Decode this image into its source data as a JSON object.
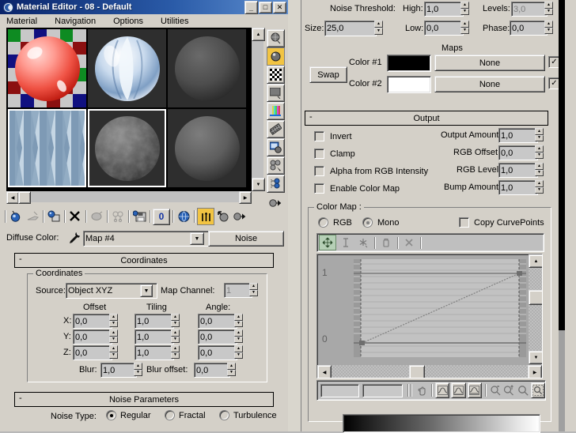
{
  "window": {
    "title": "Material Editor - 08 - Default",
    "system_icon": "material-editor-icon",
    "buttons": {
      "minimize": "_",
      "maximize": "□",
      "close": "✕"
    },
    "menu": [
      "Material",
      "Navigation",
      "Options",
      "Utilities"
    ]
  },
  "sample_slots": [
    {
      "name": "slot-1",
      "preview": "red-sphere-checker",
      "selected": false
    },
    {
      "name": "slot-2",
      "preview": "blue-glass-sphere",
      "selected": false
    },
    {
      "name": "slot-3",
      "preview": "dark-grey-sphere",
      "selected": false
    },
    {
      "name": "slot-4",
      "preview": "blue-diamond-pattern",
      "selected": true
    },
    {
      "name": "slot-5",
      "preview": "noisy-grey-sphere",
      "selected": true
    },
    {
      "name": "slot-6",
      "preview": "grey-sphere",
      "selected": false
    }
  ],
  "vertical_toolbar": [
    {
      "name": "sample-type-icon",
      "glyph": "●",
      "active": false
    },
    {
      "name": "backlight-icon",
      "glyph": "●",
      "active": true
    },
    {
      "name": "background-checker-icon",
      "glyph": "▦",
      "active": false
    },
    {
      "name": "sample-uv-tiling-icon",
      "glyph": "■",
      "active": false
    },
    {
      "name": "video-color-check-icon",
      "glyph": "▐",
      "active": false
    },
    {
      "name": "make-preview-icon",
      "glyph": "☰",
      "active": false
    },
    {
      "name": "options-icon",
      "glyph": "▣",
      "active": false
    },
    {
      "name": "select-by-material-icon",
      "glyph": "∴",
      "active": false
    },
    {
      "name": "material-map-navigator-icon",
      "glyph": "⋮",
      "active": false
    },
    {
      "name": "put-material-to-scene-icon",
      "glyph": "➡",
      "active": false
    }
  ],
  "horizontal_toolbar": [
    {
      "name": "get-material-icon",
      "glyph": "●",
      "active": false
    },
    {
      "name": "put-material-to-scene-icon",
      "glyph": "✒",
      "active": false,
      "disabled": true
    },
    {
      "name": "assign-material-to-selection-icon",
      "glyph": "▧",
      "active": false
    },
    {
      "name": "reset-map-icon",
      "glyph": "✕",
      "active": false
    },
    {
      "name": "make-material-copy-icon",
      "glyph": "⬬",
      "active": false,
      "disabled": true
    },
    {
      "name": "make-unique-icon",
      "glyph": "⛓",
      "active": false,
      "disabled": true
    },
    {
      "name": "put-to-library-icon",
      "glyph": "Ὃe",
      "active": false
    },
    {
      "name": "material-effects-channel-icon",
      "glyph": "0",
      "active": false
    },
    {
      "name": "show-map-in-viewport-icon",
      "glyph": "ἱ0",
      "active": false
    },
    {
      "name": "show-end-result-icon",
      "glyph": "║",
      "active": true
    },
    {
      "name": "go-to-parent-icon",
      "glyph": "⬆",
      "active": false
    },
    {
      "name": "go-forward-to-sibling-icon",
      "glyph": "➡",
      "active": false
    }
  ],
  "map_bar": {
    "label": "Diffuse Color:",
    "eyedropper_icon": "eyedropper-icon",
    "map_name": "Map #4",
    "dropdown_arrow": "▼",
    "map_type": "Noise"
  },
  "coordinates": {
    "rollout_title": "Coordinates",
    "rollout_state": "-",
    "group_label": "Coordinates",
    "source_label": "Source:",
    "source_value": "Object XYZ",
    "map_channel_label": "Map Channel:",
    "map_channel_value": "1",
    "col_offset": "Offset",
    "col_tiling": "Tiling",
    "col_angle": "Angle:",
    "rows": [
      {
        "axis": "X:",
        "offset": "0,0",
        "tiling": "1,0",
        "angle": "0,0"
      },
      {
        "axis": "Y:",
        "offset": "0,0",
        "tiling": "1,0",
        "angle": "0,0"
      },
      {
        "axis": "Z:",
        "offset": "0,0",
        "tiling": "1,0",
        "angle": "0,0"
      }
    ],
    "blur_label": "Blur:",
    "blur_value": "1,0",
    "blur_offset_label": "Blur offset:",
    "blur_offset_value": "0,0"
  },
  "noise_parameters": {
    "rollout_title": "Noise Parameters",
    "rollout_state": "-",
    "noise_type_label": "Noise Type:",
    "options": [
      {
        "label": "Regular",
        "selected": true
      },
      {
        "label": "Fractal",
        "selected": false
      },
      {
        "label": "Turbulence",
        "selected": false
      }
    ],
    "threshold_label": "Noise Threshold:",
    "high_label": "High:",
    "high_value": "1,0",
    "low_label": "Low:",
    "low_value": "0,0",
    "levels_label": "Levels:",
    "levels_value": "3,0",
    "levels_disabled": true,
    "size_label": "Size:",
    "size_value": "25,0",
    "phase_label": "Phase:",
    "phase_value": "0,0",
    "maps_header": "Maps",
    "swap_label": "Swap",
    "color1_label": "Color #1",
    "color1_value": "#000000",
    "color2_label": "Color #2",
    "color2_value": "#ffffff",
    "map1_label": "None",
    "map1_checked": true,
    "map2_label": "None",
    "map2_checked": true
  },
  "output": {
    "rollout_title": "Output",
    "rollout_state": "-",
    "checkboxes": [
      {
        "label": "Invert",
        "checked": false
      },
      {
        "label": "Clamp",
        "checked": false
      },
      {
        "label": "Alpha from RGB Intensity",
        "checked": false
      },
      {
        "label": "Enable Color Map",
        "checked": false
      }
    ],
    "spinners": [
      {
        "label": "Output Amount:",
        "value": "1,0"
      },
      {
        "label": "RGB Offset:",
        "value": "0,0"
      },
      {
        "label": "RGB Level:",
        "value": "1,0"
      },
      {
        "label": "Bump Amount:",
        "value": "1,0"
      }
    ],
    "color_map": {
      "group_label": "Color Map :",
      "rgb_label": "RGB",
      "mono_label": "Mono",
      "mono_selected": true,
      "disabled": true,
      "copy_curve_label": "Copy CurvePoints",
      "copy_curve_checked": false,
      "curve_toolbar": [
        {
          "name": "move-point-icon",
          "glyph": "✣",
          "active": true
        },
        {
          "name": "scale-point-icon",
          "glyph": "↕",
          "active": false
        },
        {
          "name": "add-point-icon",
          "glyph": "✳",
          "active": false
        },
        {
          "name": "delete-point-icon",
          "glyph": "⍾",
          "active": false
        },
        {
          "name": "reset-curve-icon",
          "glyph": "✕",
          "active": false
        }
      ],
      "axis_top": "1",
      "axis_bottom": "0",
      "nav_toolbar": [
        {
          "name": "pan-icon",
          "glyph": "✋"
        },
        {
          "name": "zoom-extents-horizontal-icon",
          "glyph": "⤳"
        },
        {
          "name": "zoom-extents-vertical-icon",
          "glyph": "⤳"
        },
        {
          "name": "zoom-extents-icon",
          "glyph": "⤳"
        },
        {
          "name": "zoom-horizontal-icon",
          "glyph": "⚲"
        },
        {
          "name": "zoom-vertical-icon",
          "glyph": "⚲"
        },
        {
          "name": "zoom-icon",
          "glyph": "⚲"
        },
        {
          "name": "zoom-region-icon",
          "glyph": "⚲"
        }
      ],
      "field_left": "",
      "field_right": ""
    }
  },
  "chart_data": {
    "type": "line",
    "title": "Color Map Curve",
    "x": [
      0,
      1
    ],
    "values": [
      0,
      1
    ],
    "xlabel": "",
    "ylabel": "",
    "ylim": [
      0,
      1
    ],
    "xlim": [
      0,
      1
    ],
    "grid": true,
    "points": [
      {
        "x": 0,
        "y": 0
      },
      {
        "x": 1,
        "y": 1
      }
    ]
  }
}
